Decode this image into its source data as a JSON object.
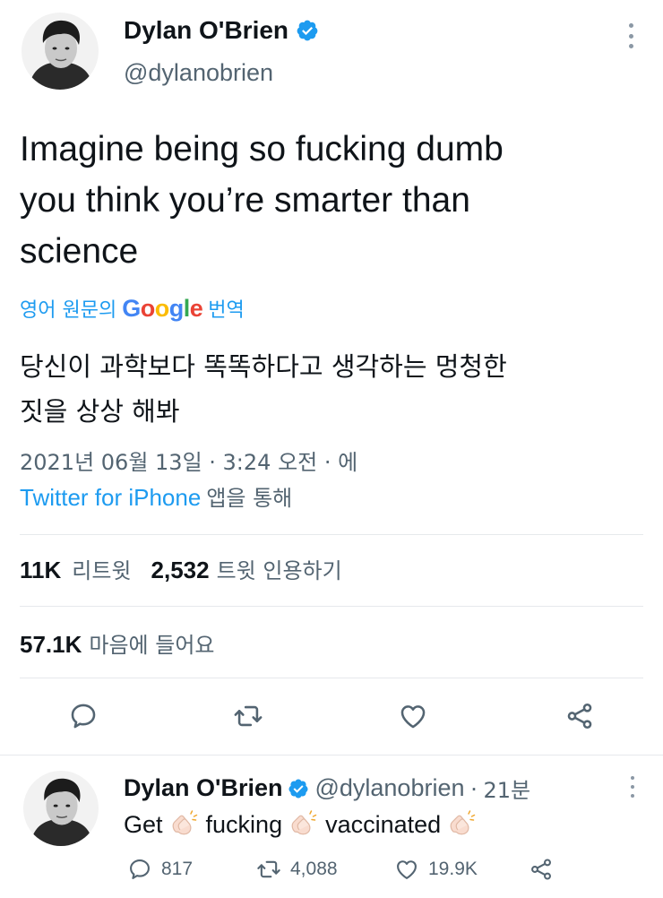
{
  "tweet": {
    "author": {
      "display_name": "Dylan O'Brien",
      "handle": "@dylanobrien",
      "verified": true
    },
    "text_lines": [
      "Imagine being so fucking dumb",
      "you think you’re smarter than",
      "science"
    ],
    "translate": {
      "prefix": "영어 원문의",
      "logo": "Google",
      "suffix": "번역"
    },
    "translated_lines": [
      "당신이 과학보다 똑똑하다고 생각하는 멍청한",
      "짓을 상상 해봐"
    ],
    "timestamp": "2021년 06월 13일 · 3:24 오전 · 에",
    "source": {
      "link": "Twitter for iPhone",
      "suffix": "앱을 통해"
    },
    "stats": {
      "retweets": "11K",
      "retweets_label": "리트윗",
      "quotes": "2,532",
      "quotes_label": "트윗 인용하기",
      "likes": "57.1K",
      "likes_label": "마음에 들어요"
    },
    "actions": [
      "reply-icon",
      "retweet-icon",
      "like-icon",
      "share-icon"
    ]
  },
  "reply": {
    "author": {
      "display_name": "Dylan O'Brien",
      "handle": "@dylanobrien",
      "time": "21분"
    },
    "text_parts": [
      "Get",
      "fucking",
      "vaccinated"
    ],
    "stats": {
      "replies": "817",
      "retweets": "4,088",
      "likes": "19.9K"
    }
  },
  "colors": {
    "accent": "#1d9bf0",
    "text": "#0f1419",
    "secondary": "#536471",
    "divider": "#e6e9ec"
  }
}
